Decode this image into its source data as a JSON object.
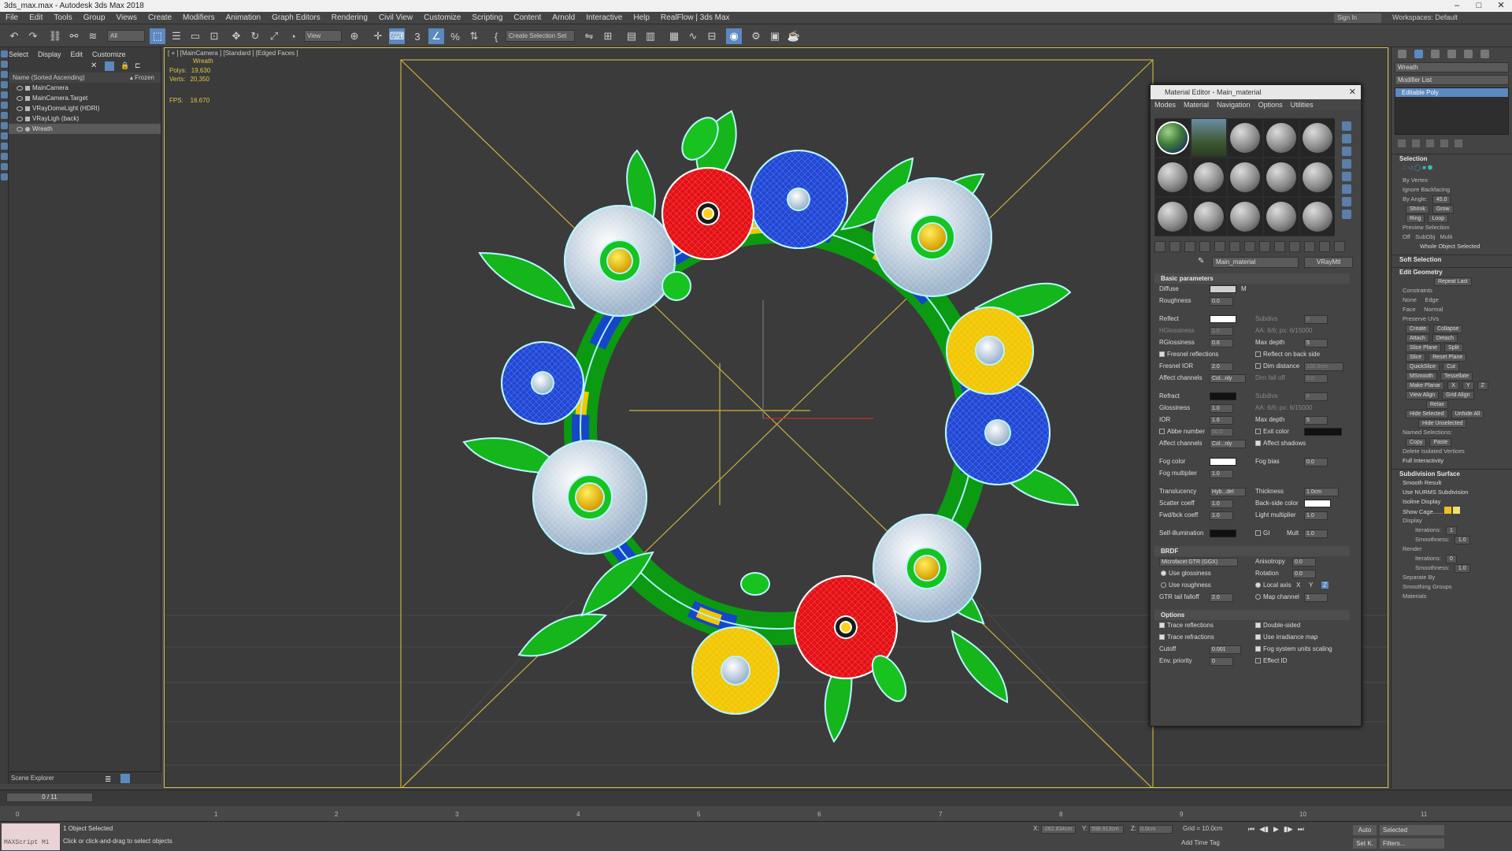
{
  "window": {
    "title": "3ds_max.max - Autodesk 3ds Max 2018"
  },
  "menu": [
    "File",
    "Edit",
    "Tools",
    "Group",
    "Views",
    "Create",
    "Modifiers",
    "Animation",
    "Graph Editors",
    "Rendering",
    "Civil View",
    "Customize",
    "Scripting",
    "Content",
    "Arnold",
    "Interactive",
    "Help",
    "RealFlow | 3ds Max"
  ],
  "header": {
    "signin": "Sign In",
    "workspaces_label": "Workspaces:",
    "workspaces_value": "Default"
  },
  "toolbar": {
    "filter": "All",
    "view": "View",
    "selection_set": "Create Selection Set"
  },
  "scene_explorer": {
    "tabs": [
      "Select",
      "Display",
      "Edit",
      "Customize"
    ],
    "column_name": "Name (Sorted Ascending)",
    "column_frozen": "▴ Frozen",
    "items": [
      {
        "name": "MainCamera"
      },
      {
        "name": "MainCamera.Target"
      },
      {
        "name": "VRayDomeLight (HDRI)"
      },
      {
        "name": "VRayLigh (back)"
      },
      {
        "name": "Wreath",
        "selected": true
      }
    ],
    "footer": "Scene Explorer"
  },
  "viewport": {
    "label": "[ + ] [MainCamera ] [Standard ] [Edged Faces ]",
    "object_name": "Wreath",
    "polys_label": "Polys:",
    "polys_value": "19,630",
    "verts_label": "Verts:",
    "verts_value": "20,350",
    "fps_label": "FPS:",
    "fps_value": "16.670"
  },
  "material_editor": {
    "title": "Material Editor - Main_material",
    "menus": [
      "Modes",
      "Material",
      "Navigation",
      "Options",
      "Utilities"
    ],
    "material_name": "Main_material",
    "material_type": "VRayMtl",
    "rollouts": {
      "basic": "Basic parameters",
      "brdf": "BRDF",
      "options": "Options"
    },
    "params": {
      "diffuse": "Diffuse",
      "diffuse_m": "M",
      "roughness": "Roughness",
      "roughness_v": "0.0",
      "reflect": "Reflect",
      "subdivs": "Subdivs",
      "subdivs_v": "8",
      "hglossiness": "HGlossiness",
      "hglossiness_v": "1.0",
      "aa": "AA: 6/6; px: 6/15000",
      "rglossiness": "RGlossiness",
      "rglossiness_v": "0.6",
      "maxdepth": "Max depth",
      "maxdepth_v": "5",
      "fresnel": "Fresnel reflections",
      "reflect_back": "Reflect on back side",
      "fresnel_ior": "Fresnel IOR",
      "fresnel_ior_v": "2.0",
      "dim_distance": "Dim distance",
      "dim_distance_v": "100.0cm",
      "affect_channels": "Affect channels",
      "affect_channels_v": "Col...nly",
      "dim_falloff": "Dim fall off",
      "dim_falloff_v": "0.0",
      "refract": "Refract",
      "rsubdivs": "Subdivs",
      "rsubdivs_v": "8",
      "glossiness": "Glossiness",
      "glossiness_v": "1.0",
      "raa": "AA: 6/6; px: 6/15000",
      "ior": "IOR",
      "ior_v": "1.6",
      "rmaxdepth": "Max depth",
      "rmaxdepth_v": "5",
      "abbe": "Abbe number",
      "abbe_v": "50.0",
      "exit_color": "Exit color",
      "r_affect": "Affect channels",
      "r_affect_v": "Col...nly",
      "affect_shadows": "Affect shadows",
      "fog_color": "Fog color",
      "fog_bias": "Fog bias",
      "fog_bias_v": "0.0",
      "fog_mult": "Fog multiplier",
      "fog_mult_v": "1.0",
      "translucency": "Translucency",
      "translucency_v": "Hyb...del",
      "thickness": "Thickness",
      "thickness_v": "1.0cm",
      "scatter": "Scatter coeff",
      "scatter_v": "1.0",
      "backside": "Back-side color",
      "fwdbck": "Fwd/bck coeff",
      "fwdbck_v": "1.0",
      "light_mult": "Light multiplier",
      "light_mult_v": "1.0",
      "selfillum": "Self-illumination",
      "gi": "GI",
      "mult": "Mult",
      "mult_v": "1.0",
      "brdf_type": "Microfacet GTR (GGX)",
      "anisotropy": "Anisotropy",
      "anisotropy_v": "0.0",
      "use_gloss": "Use glossiness",
      "rotation": "Rotation",
      "rotation_v": "0.0",
      "use_rough": "Use roughness",
      "local_axis": "Local axis",
      "ax_x": "X",
      "ax_y": "Y",
      "ax_z": "Z",
      "gtr": "GTR tail falloff",
      "gtr_v": "2.0",
      "map_channel": "Map channel",
      "map_channel_v": "1",
      "trace_refl": "Trace reflections",
      "double_sided": "Double-sided",
      "trace_refr": "Trace refractions",
      "use_irr": "Use irradiance map",
      "cutoff": "Cutoff",
      "cutoff_v": "0.001",
      "fog_units": "Fog system units scaling",
      "env_priority": "Env. priority",
      "env_priority_v": "0",
      "effect_id": "Effect ID"
    }
  },
  "command_panel": {
    "object_name": "Wreath",
    "modifier_list": "Modifier List",
    "stack_item": "Editable Poly",
    "selection": "Selection",
    "by_vertex": "By Vertex",
    "ignore_backfacing": "Ignore Backfacing",
    "by_angle": "By Angle:",
    "by_angle_v": "45.0",
    "shrink": "Shrink",
    "grow": "Grow",
    "ring": "Ring",
    "loop": "Loop",
    "preview_selection": "Preview Selection",
    "off": "Off",
    "subobj": "SubObj",
    "multi": "Multi",
    "whole_selected": "Whole Object Selected",
    "soft_selection": "Soft Selection",
    "edit_geometry": "Edit Geometry",
    "repeat_last": "Repeat Last",
    "constraints": "Constraints",
    "none": "None",
    "edge": "Edge",
    "face": "Face",
    "normal": "Normal",
    "preserve_uvs": "Preserve UVs",
    "create": "Create",
    "collapse": "Collapse",
    "attach": "Attach",
    "detach": "Detach",
    "slice_plane": "Slice Plane",
    "split": "Split",
    "slice": "Slice",
    "reset_plane": "Reset Plane",
    "quickslice": "QuickSlice",
    "cut": "Cut",
    "msmooth": "MSmooth",
    "tessellate": "Tessellate",
    "make_planar": "Make Planar",
    "x": "X",
    "y": "Y",
    "z": "Z",
    "view_align": "View Align",
    "grid_align": "Grid Align",
    "relax": "Relax",
    "hide_selected": "Hide Selected",
    "unhide_all": "Unhide All",
    "hide_unselected": "Hide Unselected",
    "named_selections": "Named Selections:",
    "copy": "Copy",
    "paste": "Paste",
    "delete_isolated": "Delete Isolated Vertices",
    "full_interactivity": "Full Interactivity",
    "subdivision_surface": "Subdivision Surface",
    "smooth_result": "Smooth Result",
    "use_nurms": "Use NURMS Subdivision",
    "isoline": "Isoline Display",
    "show_cage": "Show Cage......",
    "display": "Display",
    "iterations": "Iterations:",
    "iterations_v": "1",
    "smoothness": "Smoothness:",
    "smoothness_v": "1.0",
    "render": "Render",
    "r_iterations_v": "0",
    "r_smoothness_v": "1.0",
    "separate_by": "Separate By",
    "smoothing_groups": "Smoothing Groups",
    "materials": "Materials"
  },
  "timeline": {
    "frame": "0 / 11",
    "ticks": [
      "0",
      "1",
      "2",
      "3",
      "4",
      "5",
      "6",
      "7",
      "8",
      "9",
      "10",
      "11"
    ]
  },
  "status": {
    "maxscript": "MAXScript Mi",
    "selected": "1 Object Selected",
    "hint": "Click or click-and-drag to select objects",
    "x_label": "X:",
    "x_value": "-262.834cm",
    "y_label": "Y:",
    "y_value": "598.913cm",
    "z_label": "Z:",
    "z_value": "0.0cm",
    "grid": "Grid = 10.0cm",
    "add_time_tag": "Add Time Tag",
    "auto": "Auto",
    "selected_dd": "Selected",
    "setk": "Set K.",
    "filters": "Filters...",
    "frame_field": "0"
  },
  "colors": {
    "accent": "#5b89c0",
    "viewport_border": "#d8c24a",
    "stats_text": "#e1c64b"
  }
}
